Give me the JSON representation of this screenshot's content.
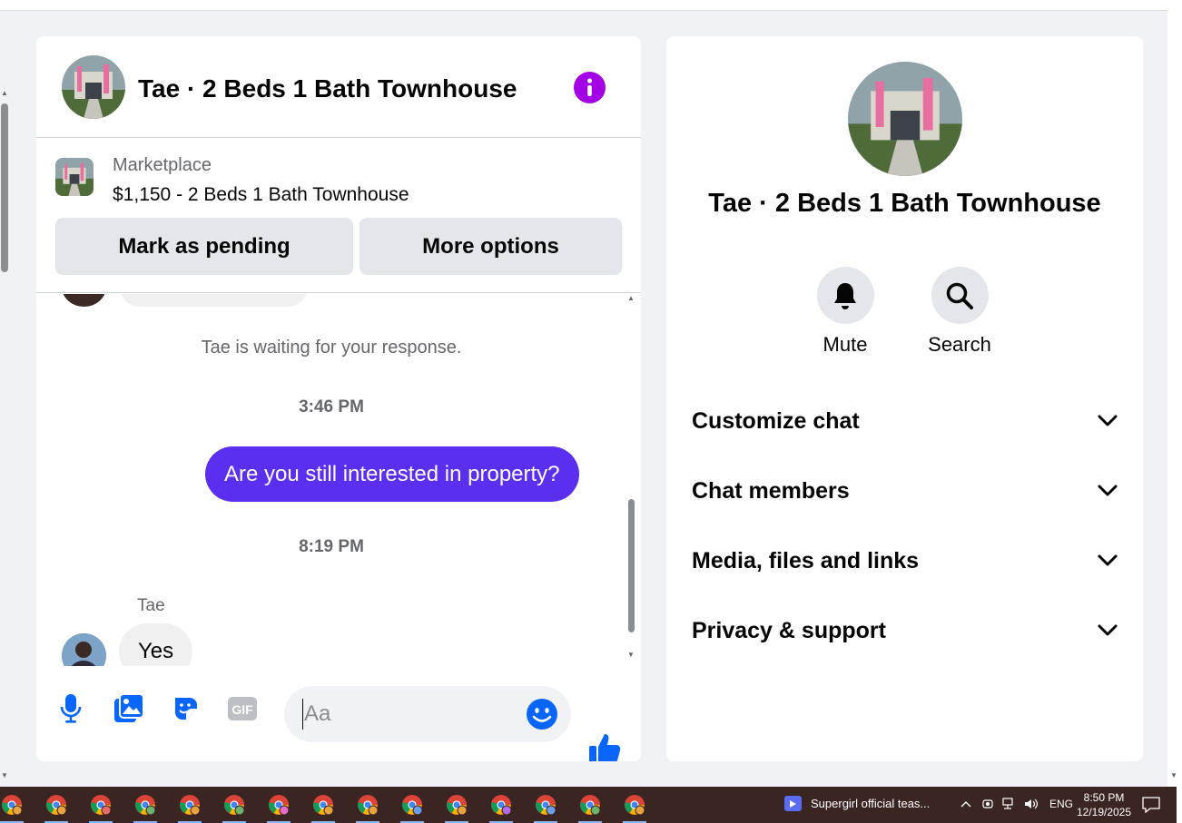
{
  "chat": {
    "title": "Tae · 2 Beds 1 Bath Townhouse",
    "info_button": "info-icon"
  },
  "marketplace": {
    "label": "Marketplace",
    "listing": "$1,150 - 2 Beds 1 Bath Townhouse",
    "buttons": {
      "pending": "Mark as pending",
      "more": "More options"
    }
  },
  "messages": {
    "system_note": "Tae is waiting for your response.",
    "timestamp_1": "3:46 PM",
    "outgoing_1": "Are you still interested in property?",
    "timestamp_2": "8:19 PM",
    "sender": "Tae",
    "incoming_1": "Yes"
  },
  "composer": {
    "placeholder": "Aa",
    "icons": [
      "microphone-icon",
      "photo-icon",
      "sticker-icon",
      "gif-icon",
      "emoji-icon",
      "thumbs-up-icon"
    ]
  },
  "info_panel": {
    "title": "Tae · 2 Beds 1 Bath Townhouse",
    "actions": {
      "mute": "Mute",
      "search": "Search"
    },
    "sections": {
      "customize": "Customize chat",
      "members": "Chat members",
      "media": "Media, files and links",
      "privacy": "Privacy & support"
    }
  },
  "taskbar": {
    "media_title": "Supergirl official teas...",
    "language": "ENG",
    "time": "8:50 PM",
    "date": "12/19/2025"
  },
  "colors": {
    "accent_purple": "#a400e6",
    "outgoing_bubble": "#5b2ff0",
    "icon_blue": "#0866ff",
    "taskbar": "#3b2522"
  }
}
